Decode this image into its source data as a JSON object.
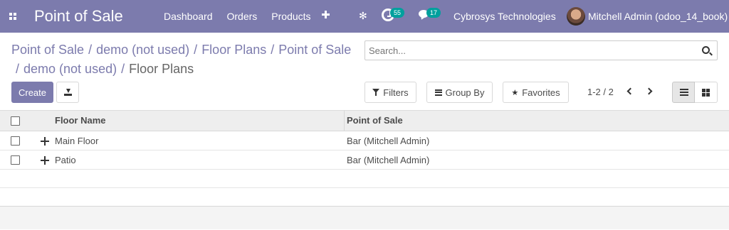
{
  "navbar": {
    "app_title": "Point of Sale",
    "menu": [
      "Dashboard",
      "Orders",
      "Products"
    ],
    "activity_count": "55",
    "message_count": "17",
    "company": "Cybrosys Technologies",
    "user": "Mitchell Admin (odoo_14_book)",
    "colors": {
      "navbar_bg": "#7c7bad",
      "badge_bg": "#00a09d"
    }
  },
  "breadcrumb": {
    "items": [
      "Point of Sale",
      "demo (not used)",
      "Floor Plans",
      "Point of Sale",
      "demo (not used)"
    ],
    "active": "Floor Plans",
    "separator": "/"
  },
  "search": {
    "placeholder": "Search..."
  },
  "toolbar": {
    "create_label": "Create",
    "filters_label": "Filters",
    "groupby_label": "Group By",
    "favorites_label": "Favorites",
    "pager": "1-2 / 2"
  },
  "table": {
    "columns": [
      "Floor Name",
      "Point of Sale"
    ],
    "rows": [
      {
        "floor_name": "Main Floor",
        "point_of_sale": "Bar (Mitchell Admin)"
      },
      {
        "floor_name": "Patio",
        "point_of_sale": "Bar (Mitchell Admin)"
      }
    ]
  }
}
